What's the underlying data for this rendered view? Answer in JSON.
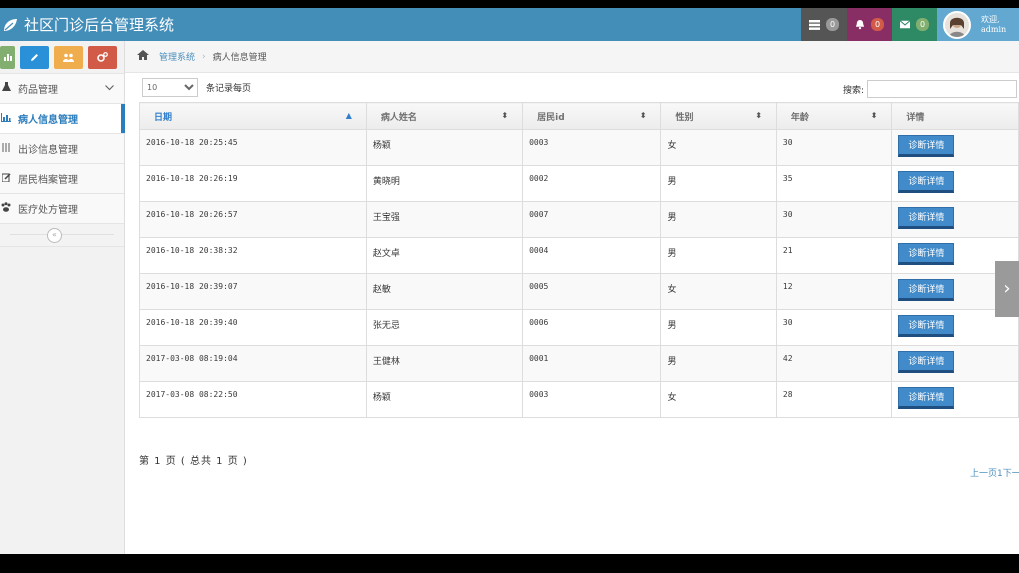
{
  "app": {
    "title": "社区门诊后台管理系统"
  },
  "navbar": {
    "tasks_count": "0",
    "notifications_count": "0",
    "messages_count": "0",
    "welcome": "欢迎,",
    "username": "admin"
  },
  "sidebar": {
    "items": [
      {
        "label": "药品管理"
      },
      {
        "label": "病人信息管理"
      },
      {
        "label": "出诊信息管理"
      },
      {
        "label": "居民档案管理"
      },
      {
        "label": "医疗处方管理"
      }
    ],
    "collapse_glyph": "«"
  },
  "breadcrumb": {
    "root": "管理系统",
    "current": "病人信息管理"
  },
  "table_controls": {
    "page_length": "10",
    "page_length_suffix": "条记录每页",
    "search_label": "搜索:"
  },
  "table": {
    "columns": [
      "日期",
      "病人姓名",
      "居民id",
      "性别",
      "年龄",
      "详情"
    ],
    "rows": [
      {
        "date": "2016-10-18 20:25:45",
        "name": "杨颖",
        "rid": "0003",
        "sex": "女",
        "age": "30",
        "action": "诊断详情"
      },
      {
        "date": "2016-10-18 20:26:19",
        "name": "黄晓明",
        "rid": "0002",
        "sex": "男",
        "age": "35",
        "action": "诊断详情"
      },
      {
        "date": "2016-10-18 20:26:57",
        "name": "王宝强",
        "rid": "0007",
        "sex": "男",
        "age": "30",
        "action": "诊断详情"
      },
      {
        "date": "2016-10-18 20:38:32",
        "name": "赵文卓",
        "rid": "0004",
        "sex": "男",
        "age": "21",
        "action": "诊断详情"
      },
      {
        "date": "2016-10-18 20:39:07",
        "name": "赵敏",
        "rid": "0005",
        "sex": "女",
        "age": "12",
        "action": "诊断详情"
      },
      {
        "date": "2016-10-18 20:39:40",
        "name": "张无忌",
        "rid": "0006",
        "sex": "男",
        "age": "30",
        "action": "诊断详情"
      },
      {
        "date": "2017-03-08 08:19:04",
        "name": "王健林",
        "rid": "0001",
        "sex": "男",
        "age": "42",
        "action": "诊断详情"
      },
      {
        "date": "2017-03-08 08:22:50",
        "name": "杨颖",
        "rid": "0003",
        "sex": "女",
        "age": "28",
        "action": "诊断详情"
      }
    ]
  },
  "pagination": {
    "info": "第 1 页 ( 总共 1 页 )",
    "nav": "上一页1下一"
  },
  "colors": {
    "navbar": "#438eb9",
    "accent": "#2b7dbc",
    "button": "#428bca"
  }
}
